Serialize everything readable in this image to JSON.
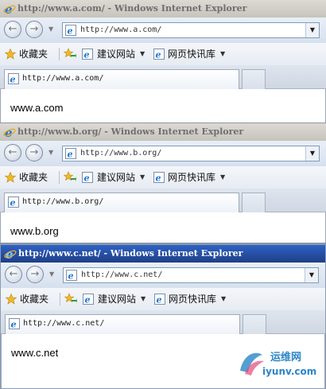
{
  "windows": [
    {
      "title": "http://www.a.com/ - Windows Internet Explorer",
      "address": "http://www.a.com/",
      "tab_title": "http://www.a.com/",
      "page_text": "www.a.com",
      "active": false
    },
    {
      "title": "http://www.b.org/ - Windows Internet Explorer",
      "address": "http://www.b.org/",
      "tab_title": "http://www.b.org/",
      "page_text": "www.b.org",
      "active": false
    },
    {
      "title": "http://www.c.net/ - Windows Internet Explorer",
      "address": "http://www.c.net/",
      "tab_title": "http://www.c.net/",
      "page_text": "www.c.net",
      "active": true
    }
  ],
  "favorites": {
    "label": "收藏夹",
    "suggested_sites": "建议网站",
    "web_slice_gallery": "网页快讯库"
  },
  "watermark": {
    "text_top": "运维网",
    "text_bottom": "iyunv.com"
  },
  "colors": {
    "active_title": "#2e62c4",
    "inactive_title": "#c6c4bc",
    "ie_blue": "#1e78d2",
    "fav_star": "#f2b824",
    "watermark": "#2a86c8"
  },
  "icons": {
    "ie": "ie-logo-icon",
    "star": "star-icon",
    "add_favorite": "add-favorite-icon",
    "back": "back-arrow-icon",
    "forward": "forward-arrow-icon"
  }
}
